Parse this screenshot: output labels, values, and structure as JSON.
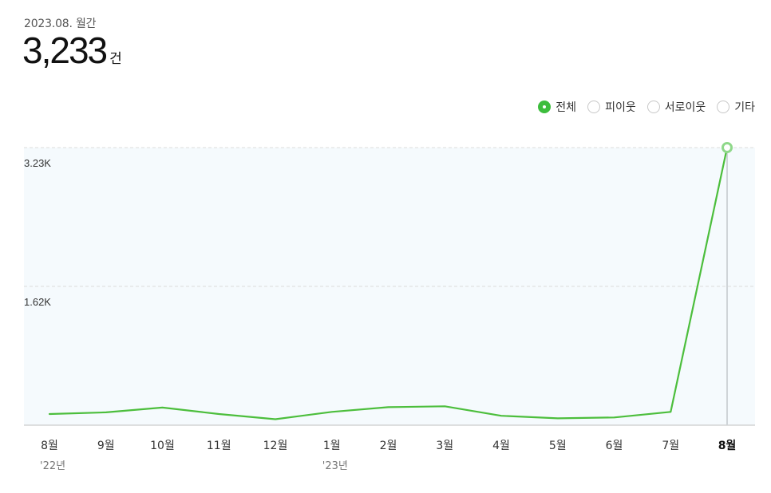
{
  "header": {
    "period": "2023.08. 월간",
    "total_value": "3,233",
    "total_unit": "건"
  },
  "filters": [
    {
      "label": "전체",
      "checked": true
    },
    {
      "label": "피이웃",
      "checked": false
    },
    {
      "label": "서로이웃",
      "checked": false
    },
    {
      "label": "기타",
      "checked": false
    }
  ],
  "colors": {
    "line": "#4cbe3c",
    "accent": "#3dbd3d"
  },
  "chart_data": {
    "type": "line",
    "categories": [
      "8월",
      "9월",
      "10월",
      "11월",
      "12월",
      "1월",
      "2월",
      "3월",
      "4월",
      "5월",
      "6월",
      "7월",
      "8월"
    ],
    "year_labels": [
      "'22년",
      "",
      "",
      "",
      "",
      "'23년",
      "",
      "",
      "",
      "",
      "",
      "",
      ""
    ],
    "values": [
      130,
      150,
      205,
      130,
      70,
      155,
      210,
      220,
      110,
      80,
      90,
      155,
      3233
    ],
    "y_ticks": [
      {
        "value": 1616,
        "label": "1.62K"
      },
      {
        "value": 3233,
        "label": "3.23K"
      }
    ],
    "ylim": [
      0,
      3233
    ],
    "highlight_index": 12,
    "grid": true,
    "legend": "none"
  }
}
